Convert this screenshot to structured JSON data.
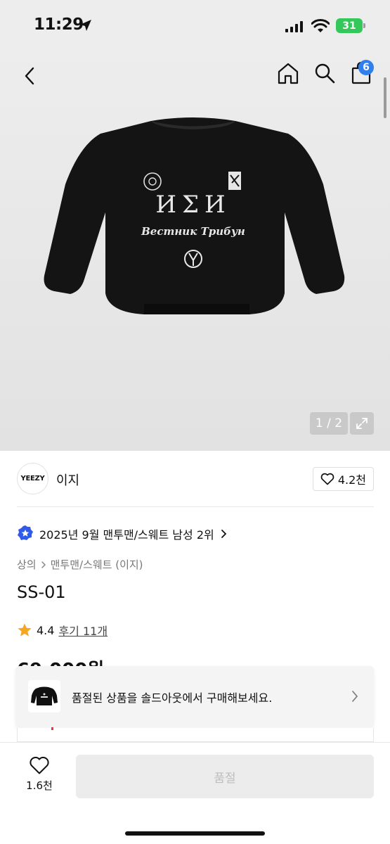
{
  "status_bar": {
    "time": "11:29",
    "battery": "31"
  },
  "header": {
    "cart_count": "6"
  },
  "gallery": {
    "counter": "1 / 2",
    "shirt_text": "ИΣИ",
    "shirt_script": "Вестник Трибун"
  },
  "brand": {
    "logo_text": "YEEZY",
    "name": "이지",
    "likes": "4.2천"
  },
  "ranking": {
    "text": "2025년 9월 맨투맨/스웨트 남성 2위"
  },
  "breadcrumb": {
    "level1": "상의",
    "level2": "맨투맨/스웨트 (이지)"
  },
  "product": {
    "title": "SS-01",
    "rating": "4.4",
    "reviews": "후기 11개",
    "price_partial": "69,000원"
  },
  "soldout_banner": {
    "text": "품절된 상품을 솔드아웃에서 구매해보세요."
  },
  "bottom_bar": {
    "wish_count": "1.6천",
    "buy_label": "품절"
  },
  "colors": {
    "accent": "#2f80ed",
    "battery": "#34c759",
    "star": "#f5a623"
  }
}
